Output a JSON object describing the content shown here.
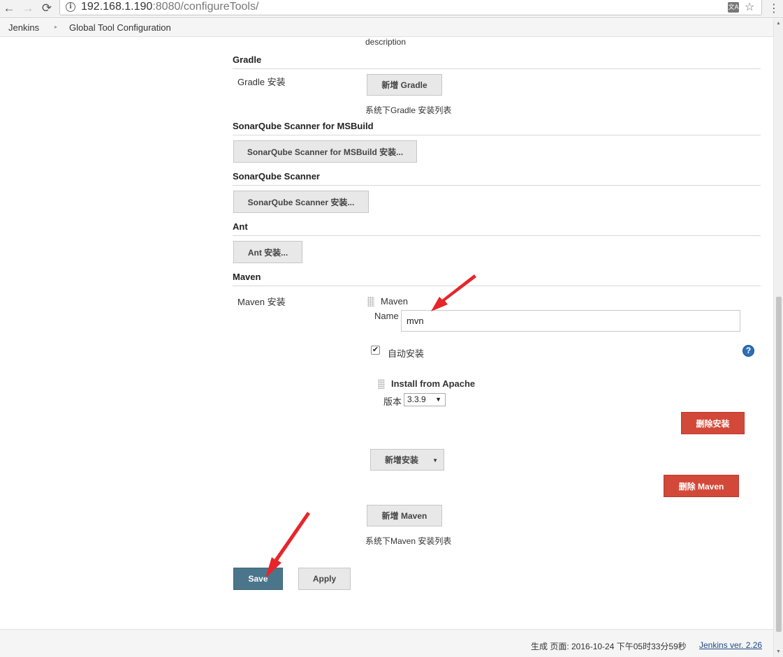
{
  "browser": {
    "url_host": "192.168.1.190",
    "url_rest": ":8080/configureTools/",
    "back_glyph": "←",
    "forward_glyph": "→",
    "reload_glyph": "⟳",
    "info_glyph": "i",
    "translate_glyph": "文A",
    "star_glyph": "☆",
    "menu_glyph": "⋮"
  },
  "breadcrumb": {
    "items": [
      "Jenkins",
      "Global Tool Configuration"
    ],
    "separator": "▸"
  },
  "top_desc": "description",
  "gradle": {
    "title": "Gradle",
    "label": "Gradle 安装",
    "add_button": "新增 Gradle",
    "list_desc": "系统下Gradle 安装列表"
  },
  "sonar_msbuild": {
    "title": "SonarQube Scanner for MSBuild",
    "button": "SonarQube Scanner for MSBuild 安装..."
  },
  "sonar_scanner": {
    "title": "SonarQube Scanner",
    "button": "SonarQube Scanner 安装..."
  },
  "ant": {
    "title": "Ant",
    "button": "Ant 安装..."
  },
  "maven": {
    "title": "Maven",
    "label": "Maven 安装",
    "item_header": "Maven",
    "name_label": "Name",
    "name_value": "mvn",
    "auto_install_label": "自动安装",
    "auto_install_checked": true,
    "check_glyph": "✔",
    "help_glyph": "?",
    "installer_title": "Install from Apache",
    "version_label": "版本",
    "version_value": "3.3.9",
    "select_arrow": "▼",
    "delete_installer_button": "删除安装",
    "add_installer_button": "新增安装",
    "add_installer_caret": "▼",
    "delete_maven_button": "删除 Maven",
    "add_maven_button": "新增 Maven",
    "list_desc": "系统下Maven 安装列表"
  },
  "actions": {
    "save": "Save",
    "apply": "Apply"
  },
  "footer": {
    "generated": "生成 页面: 2016-10-24 下午05时33分59秒",
    "version_link": "Jenkins ver. 2.26"
  },
  "colors": {
    "save_button": "#4b758b",
    "delete_button": "#d24939",
    "annotation_arrow": "#e8252a"
  }
}
